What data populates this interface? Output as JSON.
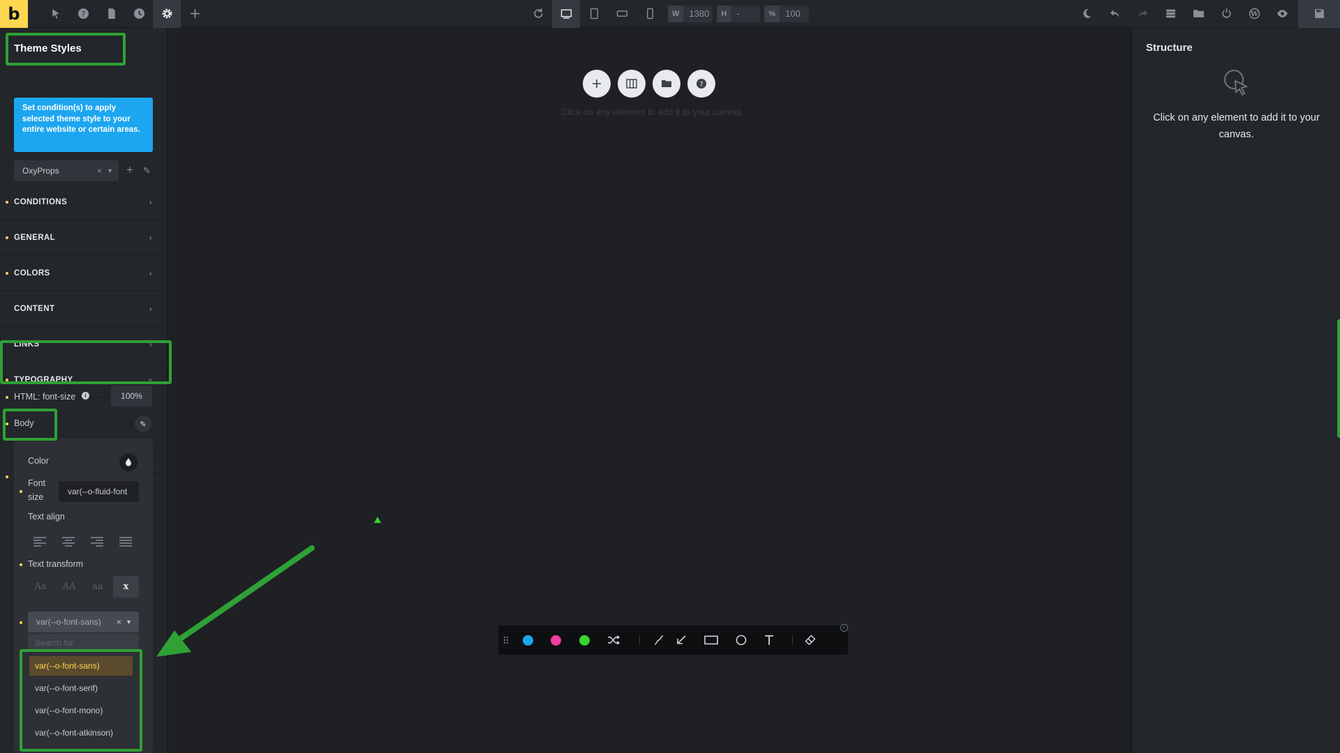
{
  "topbar": {
    "logo": "b",
    "width_key": "W",
    "width_value": "1380",
    "height_key": "H",
    "height_value": "-",
    "zoom_key": "%",
    "zoom_value": "100"
  },
  "left": {
    "title": "Theme Styles",
    "info": "Set condition(s) to apply selected theme style to your entire website or certain areas.",
    "style_select": "OxyProps",
    "sections": [
      "CONDITIONS",
      "GENERAL",
      "COLORS",
      "CONTENT",
      "LINKS",
      "TYPOGRAPHY"
    ],
    "html_font_size_label": "HTML: font-size",
    "html_font_size_value": "100%",
    "body_label": "Body"
  },
  "popup": {
    "color_label": "Color",
    "font_size_label_1": "Font",
    "font_size_label_2": "size",
    "font_size_value": "var(--o-fluid-font",
    "text_align_label": "Text align",
    "text_transform_label": "Text transform",
    "transforms": [
      "Aa",
      "AA",
      "aa",
      "x"
    ],
    "font_select": "var(--o-font-sans)",
    "search_placeholder": "Search for",
    "options": [
      "var(--o-font-sans)",
      "var(--o-font-serif)",
      "var(--o-font-mono)",
      "var(--o-font-atkinson)"
    ]
  },
  "canvas": {
    "hint": "Click on any element to add it to your canvas."
  },
  "structure": {
    "title": "Structure",
    "hint": "Click on any element to add it to your canvas."
  },
  "drawbar": {
    "colors": [
      "#1da6f0",
      "#f03ea0",
      "#38d430"
    ]
  },
  "colors": {
    "accent": "#ffd64f",
    "highlight": "#2fa135",
    "info": "#1da6f0"
  }
}
